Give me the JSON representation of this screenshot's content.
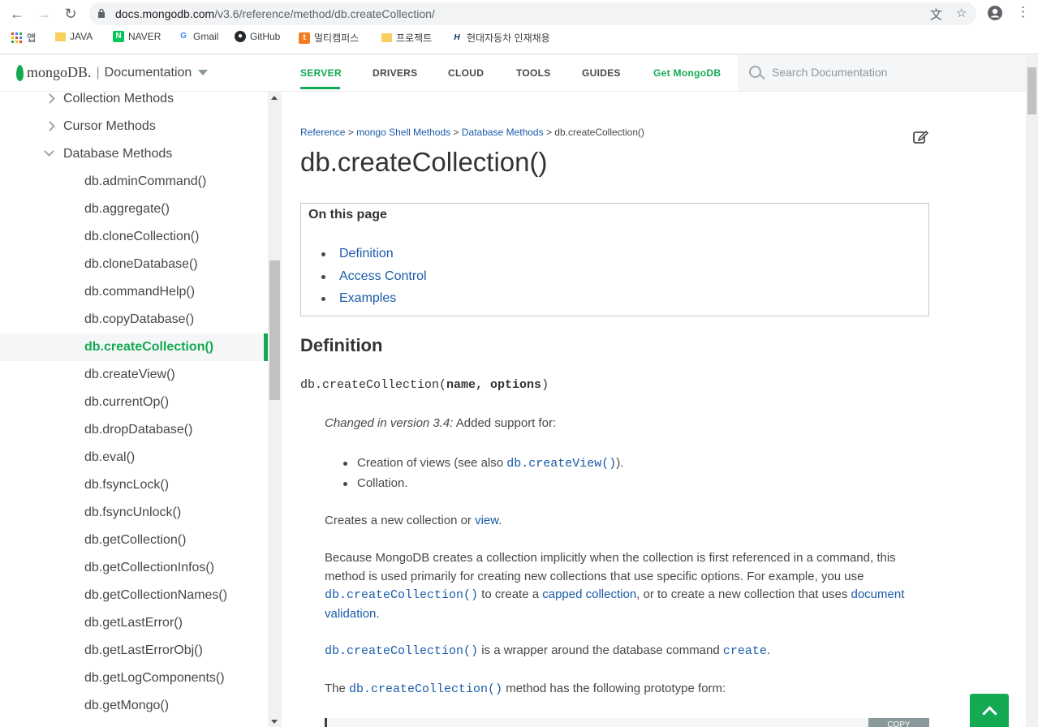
{
  "browser": {
    "url_host": "docs.mongodb.com",
    "url_path": "/v3.6/reference/method/db.createCollection/",
    "bookmarks": [
      "앱",
      "JAVA",
      "NAVER",
      "Gmail",
      "GitHub",
      "멀티캠퍼스",
      "프로젝트",
      "현대자동차 인재채용"
    ]
  },
  "header": {
    "logo": "mongoDB.",
    "separator": "|",
    "doc_title": "Documentation",
    "nav": [
      "SERVER",
      "DRIVERS",
      "CLOUD",
      "TOOLS",
      "GUIDES",
      "Get MongoDB"
    ],
    "search_placeholder": "Search Documentation"
  },
  "sidebar": {
    "sections": [
      "Collection Methods",
      "Cursor Methods",
      "Database Methods"
    ],
    "items": [
      "db.adminCommand()",
      "db.aggregate()",
      "db.cloneCollection()",
      "db.cloneDatabase()",
      "db.commandHelp()",
      "db.copyDatabase()",
      "db.createCollection()",
      "db.createView()",
      "db.currentOp()",
      "db.dropDatabase()",
      "db.eval()",
      "db.fsyncLock()",
      "db.fsyncUnlock()",
      "db.getCollection()",
      "db.getCollectionInfos()",
      "db.getCollectionNames()",
      "db.getLastError()",
      "db.getLastErrorObj()",
      "db.getLogComponents()",
      "db.getMongo()"
    ]
  },
  "breadcrumb": {
    "items": [
      "Reference",
      "mongo Shell Methods",
      "Database Methods"
    ],
    "separator": ">",
    "current": "db.createCollection()"
  },
  "page": {
    "title": "db.createCollection()",
    "on_this_page": "On this page",
    "toc": [
      "Definition",
      "Access Control",
      "Examples"
    ],
    "section_heading": "Definition",
    "signature_name": "db.createCollection(",
    "signature_args": "name, options",
    "signature_close": ")",
    "changed_label": "Changed in version 3.4:",
    "changed_text": " Added support for:",
    "bullet1_pre": "Creation of views (see also ",
    "bullet1_code": "db.createView()",
    "bullet1_post": ").",
    "bullet2": "Collation.",
    "p1_pre": "Creates a new collection or ",
    "p1_link": "view",
    "p1_post": ".",
    "p2_a": "Because MongoDB creates a collection implicitly when the collection is first referenced in a command, this method is used primarily for creating new collections that use specific options. For example, you use ",
    "p2_code": "db.createCollection()",
    "p2_b": " to create a ",
    "p2_link1": "capped collection",
    "p2_c": ", or to create a new collection that uses ",
    "p2_link2": "document validation",
    "p2_d": ".",
    "p3_code": "db.createCollection()",
    "p3_mid": " is a wrapper around the database command ",
    "p3_link": "create",
    "p3_end": ".",
    "p4_pre": "The ",
    "p4_code": "db.createCollection()",
    "p4_post": " method has the following prototype form:",
    "copy_label": "COPY"
  },
  "colors": {
    "brand_green": "#13aa52",
    "link_blue": "#1a5ba8"
  }
}
